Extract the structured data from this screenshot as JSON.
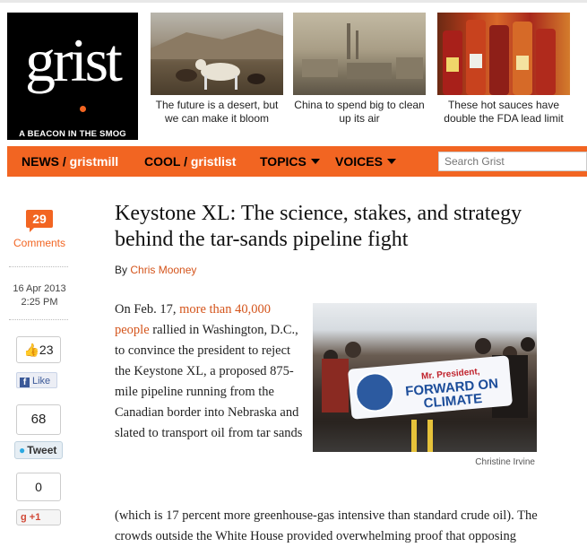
{
  "logo": {
    "word": "grist",
    "tagline": "A BEACON IN THE SMOG"
  },
  "teasers": [
    {
      "caption": "The future is a desert, but we can make it bloom"
    },
    {
      "caption": "China to spend big to clean up its air"
    },
    {
      "caption": "These hot sauces have double the FDA lead limit"
    }
  ],
  "nav": {
    "news": "NEWS /",
    "gristmill": "gristmill",
    "cool": "COOL /",
    "gristlist": "gristlist",
    "topics": "TOPICS",
    "voices": "VOICES",
    "search_placeholder": "Search Grist"
  },
  "sidebar": {
    "comment_count": "29",
    "comments_label": "Comments",
    "date": "16 Apr 2013",
    "time": "2:25 PM",
    "fb_count": "23",
    "fb_like": "Like",
    "tweet_count": "68",
    "tweet_label": "Tweet",
    "gplus_count": "0",
    "gplus_label": "+1"
  },
  "article": {
    "title": "Keystone XL: The science, stakes, and strategy behind the tar-sands pipeline fight",
    "by": "By",
    "author": "Chris Mooney",
    "p1_a": "On Feb. 17, ",
    "p1_link": "more than 40,000 people",
    "p1_b": " rallied in Washington, D.C., to convince the president to reject the Keystone XL, a proposed 875-mile pipeline running from the Canadian border into Nebraska and slated to transport oil from tar sands",
    "p1_c": "(which is 17 percent more greenhouse-gas intensive than standard crude oil). The crowds outside the White House provided overwhelming proof that opposing",
    "photo_banner_small": "Mr. President,",
    "photo_banner_big": "FORWARD ON CLIMATE",
    "photo_credit": "Christine Irvine"
  }
}
